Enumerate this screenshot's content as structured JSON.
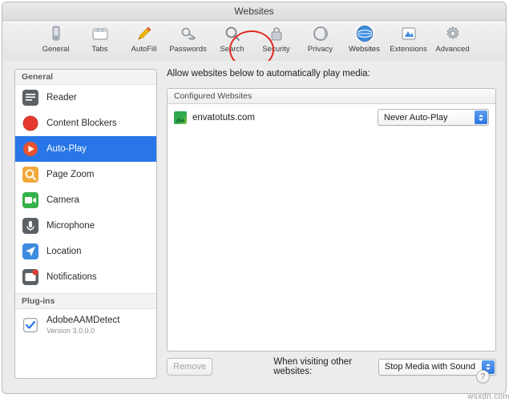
{
  "window": {
    "title": "Websites"
  },
  "toolbar": {
    "items": [
      {
        "label": "General",
        "icon": "general-icon"
      },
      {
        "label": "Tabs",
        "icon": "tabs-icon"
      },
      {
        "label": "AutoFill",
        "icon": "autofill-icon"
      },
      {
        "label": "Passwords",
        "icon": "passwords-icon"
      },
      {
        "label": "Search",
        "icon": "search-icon"
      },
      {
        "label": "Security",
        "icon": "security-icon"
      },
      {
        "label": "Privacy",
        "icon": "privacy-icon"
      },
      {
        "label": "Websites",
        "icon": "websites-icon"
      },
      {
        "label": "Extensions",
        "icon": "extensions-icon"
      },
      {
        "label": "Advanced",
        "icon": "advanced-icon"
      }
    ],
    "selected": "Websites"
  },
  "sidebar": {
    "groups": [
      {
        "header": "General",
        "items": [
          {
            "label": "Reader",
            "icon": "reader-icon",
            "selected": false
          },
          {
            "label": "Content Blockers",
            "icon": "content-blockers-icon",
            "selected": false
          },
          {
            "label": "Auto-Play",
            "icon": "auto-play-icon",
            "selected": true
          },
          {
            "label": "Page Zoom",
            "icon": "page-zoom-icon",
            "selected": false
          },
          {
            "label": "Camera",
            "icon": "camera-icon",
            "selected": false
          },
          {
            "label": "Microphone",
            "icon": "microphone-icon",
            "selected": false
          },
          {
            "label": "Location",
            "icon": "location-icon",
            "selected": false
          },
          {
            "label": "Notifications",
            "icon": "notifications-icon",
            "selected": false
          }
        ]
      },
      {
        "header": "Plug-ins",
        "items": [
          {
            "label": "AdobeAAMDetect",
            "sublabel": "Version 3.0.0.0",
            "icon": "plugin-checkbox-icon",
            "selected": false
          }
        ]
      }
    ]
  },
  "main": {
    "allow_label": "Allow websites below to automatically play media:",
    "list_header": "Configured Websites",
    "sites": [
      {
        "name": "envatotuts.com",
        "setting": "Never Auto-Play"
      }
    ],
    "remove_label": "Remove",
    "other_sites_label": "When visiting other websites:",
    "other_sites_value": "Stop Media with Sound"
  },
  "help": {
    "label": "?"
  },
  "watermark": "wsxdn.com",
  "colors": {
    "selection_blue": "#2876e8",
    "annotation_red": "#e02b20",
    "popup_blue": "#2d76e0"
  }
}
